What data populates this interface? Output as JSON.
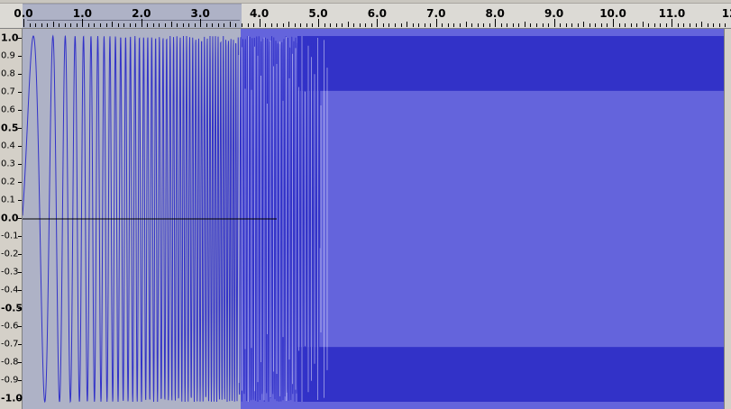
{
  "ruler": {
    "ticks": [
      {
        "label": "0.0",
        "value": 0
      },
      {
        "label": "1.0",
        "value": 1
      },
      {
        "label": "2.0",
        "value": 2
      },
      {
        "label": "3.0",
        "value": 3
      },
      {
        "label": "4.0",
        "value": 4
      },
      {
        "label": "5.0",
        "value": 5
      },
      {
        "label": "6.0",
        "value": 6
      },
      {
        "label": "7.0",
        "value": 7
      },
      {
        "label": "8.0",
        "value": 8
      },
      {
        "label": "9.0",
        "value": 9
      },
      {
        "label": "10.0",
        "value": 10
      },
      {
        "label": "11.0",
        "value": 11
      },
      {
        "label": "12",
        "value": 12
      }
    ],
    "selection_range": [
      0.0,
      3.7
    ]
  },
  "amplitude_scale": {
    "labels": [
      "1.0",
      "0.9",
      "0.8",
      "0.7",
      "0.6",
      "0.5",
      "0.4",
      "0.3",
      "0.2",
      "0.1",
      "0.0",
      "-0.1",
      "-0.2",
      "-0.3",
      "-0.4",
      "-0.5",
      "-0.6",
      "-0.7",
      "-0.8",
      "-0.9",
      "-1.0"
    ],
    "major_labels": [
      "1.0",
      "0.5",
      "0.0",
      "-0.5",
      "-1.0"
    ]
  },
  "waveform": {
    "type": "chirp",
    "background_color": "#aeb2c6",
    "wave_color": "#3232c8",
    "rms_color": "#6464dc",
    "selection_range_seconds": [
      0.0,
      3.7
    ],
    "envelope_peak": 1.0,
    "envelope_rms": 0.7
  }
}
